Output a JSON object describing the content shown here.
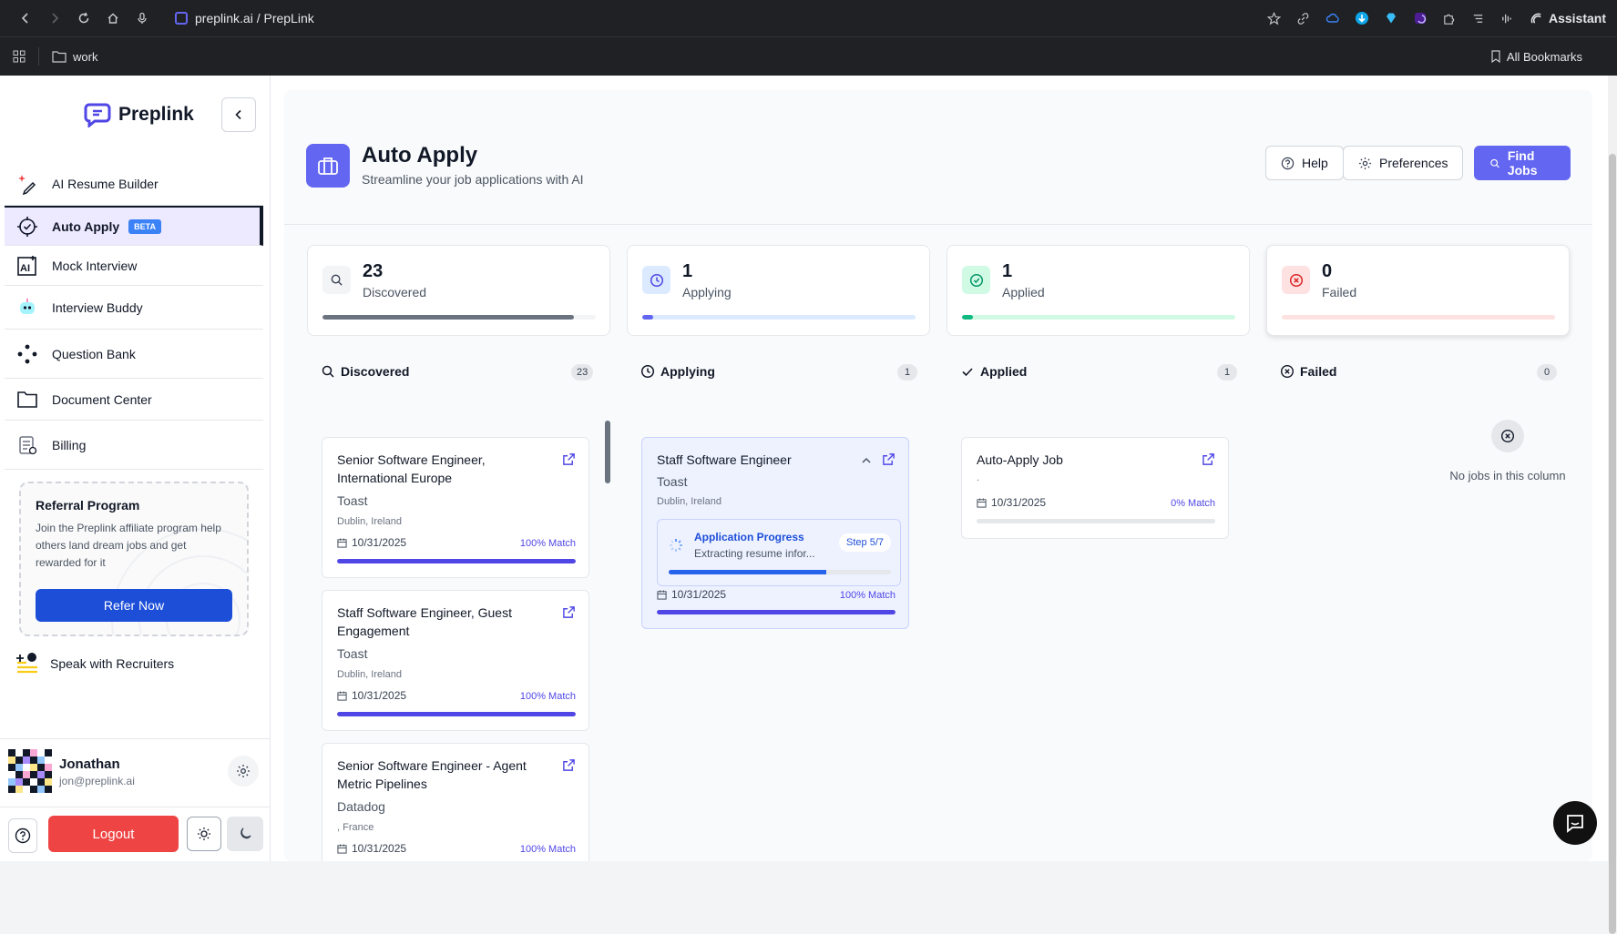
{
  "browser": {
    "url": "preplink.ai / PrepLink",
    "assistant_label": "Assistant",
    "bookmark_folder": "work",
    "all_bookmarks": "All Bookmarks"
  },
  "sidebar": {
    "logo": "Preplink",
    "items": [
      {
        "label": "AI Resume Builder"
      },
      {
        "label": "Auto Apply",
        "badge": "BETA"
      },
      {
        "label": "Mock Interview"
      },
      {
        "label": "Interview Buddy"
      },
      {
        "label": "Question Bank"
      },
      {
        "label": "Document Center"
      },
      {
        "label": "Billing"
      }
    ],
    "referral": {
      "title": "Referral Program",
      "text": "Join the Preplink affiliate program help others land dream jobs and get rewarded for it",
      "button": "Refer Now"
    },
    "recruiters": "Speak with Recruiters",
    "user": {
      "name": "Jonathan",
      "email": "jon@preplink.ai"
    },
    "logout": "Logout"
  },
  "header": {
    "title": "Auto Apply",
    "subtitle": "Streamline your job applications with AI",
    "help": "Help",
    "preferences": "Preferences",
    "find_jobs": "Find Jobs"
  },
  "stats": [
    {
      "value": "23",
      "label": "Discovered",
      "fill": 0.92,
      "color": "#6b7280",
      "track": "#f3f4f6"
    },
    {
      "value": "1",
      "label": "Applying",
      "fill": 0.04,
      "color": "#6366f1",
      "track": "#dbeafe"
    },
    {
      "value": "1",
      "label": "Applied",
      "fill": 0.04,
      "color": "#10b981",
      "track": "#d1fae5"
    },
    {
      "value": "0",
      "label": "Failed",
      "fill": 0,
      "color": "#ef4444",
      "track": "#fee2e2"
    }
  ],
  "columns": [
    {
      "name": "Discovered",
      "count": "23"
    },
    {
      "name": "Applying",
      "count": "1"
    },
    {
      "name": "Applied",
      "count": "1"
    },
    {
      "name": "Failed",
      "count": "0"
    }
  ],
  "discovered_jobs": [
    {
      "title": "Senior Software Engineer, International Europe",
      "company": "Toast",
      "location": "Dublin, Ireland",
      "date": "10/31/2025",
      "match": "100% Match",
      "match_pct": 1.0
    },
    {
      "title": "Staff Software Engineer, Guest Engagement",
      "company": "Toast",
      "location": "Dublin, Ireland",
      "date": "10/31/2025",
      "match": "100% Match",
      "match_pct": 1.0
    },
    {
      "title": "Senior Software Engineer - Agent Metric Pipelines",
      "company": "Datadog",
      "location": ", France",
      "date": "10/31/2025",
      "match": "100% Match",
      "match_pct": 1.0
    }
  ],
  "applying_job": {
    "title": "Staff Software Engineer",
    "company": "Toast",
    "location": "Dublin, Ireland",
    "progress_title": "Application Progress",
    "progress_text": "Extracting resume infor...",
    "step": "Step 5/7",
    "progress_pct": 0.71,
    "date": "10/31/2025",
    "match": "100% Match",
    "match_pct": 1.0
  },
  "applied_job": {
    "title": "Auto-Apply Job",
    "company": ".",
    "date": "10/31/2025",
    "match": "0% Match",
    "match_pct": 0
  },
  "failed_empty": "No jobs in this column"
}
